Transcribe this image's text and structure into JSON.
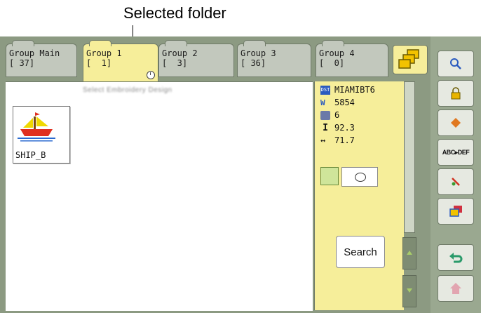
{
  "annotation": {
    "label": "Selected folder"
  },
  "tabs": [
    {
      "name": "Group Main",
      "count": "[ 37]"
    },
    {
      "name": "Group 1",
      "count": "[  1]"
    },
    {
      "name": "Group 2",
      "count": "[  3]"
    },
    {
      "name": "Group 3",
      "count": "[ 36]"
    },
    {
      "name": "Group 4",
      "count": "[  0]"
    }
  ],
  "content": {
    "header_blurred": "Select Embroidery Design",
    "designs": [
      {
        "name": "SHIP_B"
      }
    ]
  },
  "info": {
    "design_name": "MIAMIBT6",
    "stitches": "5854",
    "colors": "6",
    "height": "92.3",
    "width": "71.7"
  },
  "search_label": "Search",
  "colors": {
    "selected_tab": "#f6ee9a",
    "frame": "#8c9a82",
    "accent_green": "#a8cc6a"
  }
}
